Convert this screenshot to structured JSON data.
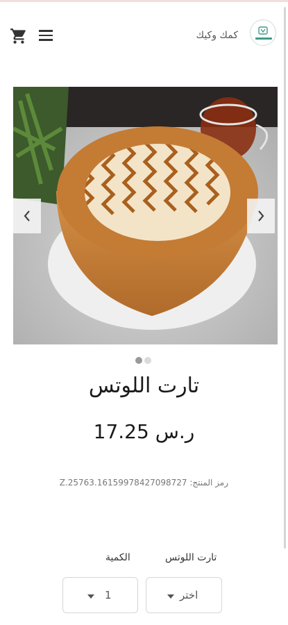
{
  "header": {
    "store_name": "كمك وكيك",
    "cart_icon": "cart-icon",
    "menu_icon": "menu-icon",
    "logo": "store-logo"
  },
  "gallery": {
    "image_alt": "تارت اللوتس",
    "slide_count": 2,
    "active_slide": 1,
    "prev_icon": "chevron-left-icon",
    "next_icon": "chevron-right-icon"
  },
  "product": {
    "title": "تارت اللوتس",
    "price": "17.25 ر.س",
    "sku_label": "رمز المنتج:",
    "sku_value": "Z.25763.16159978427098727"
  },
  "options": {
    "variant_label": "تارت اللوتس",
    "variant_value": "اختر",
    "quantity_label": "الكمية",
    "quantity_value": "1"
  },
  "colors": {
    "accent_logo": "#3f9a87",
    "text_dark": "#1a1a1a",
    "cake": "#c9863e"
  }
}
